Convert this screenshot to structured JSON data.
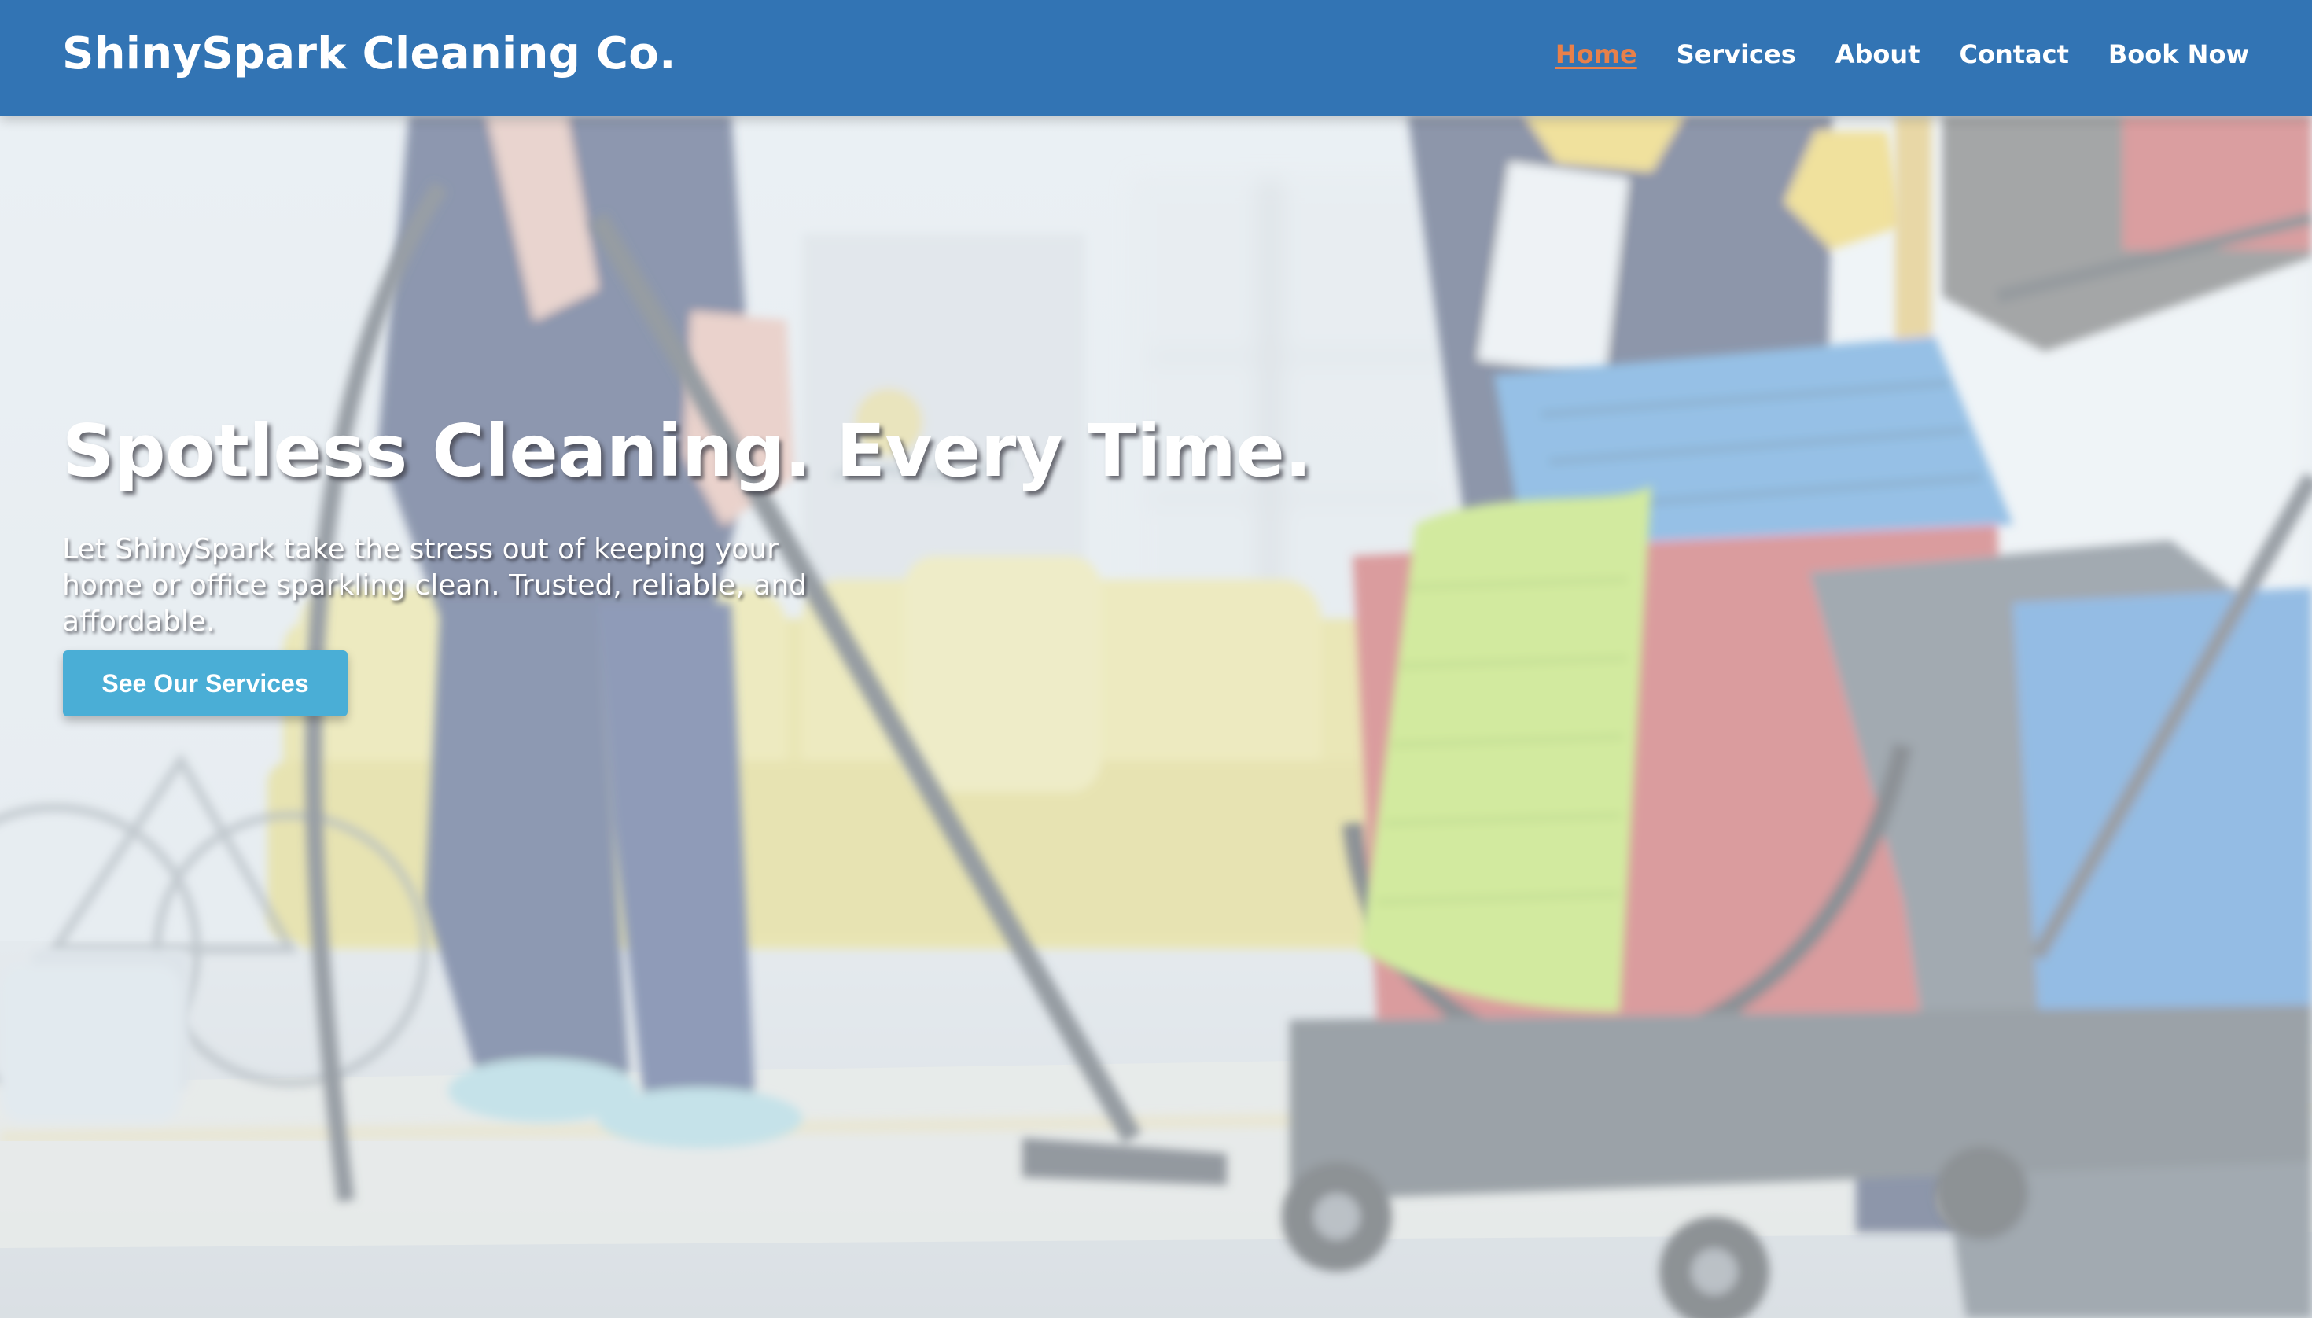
{
  "header": {
    "brand": "ShinySpark Cleaning Co.",
    "nav": [
      {
        "label": "Home",
        "active": true
      },
      {
        "label": "Services",
        "active": false
      },
      {
        "label": "About",
        "active": false
      },
      {
        "label": "Contact",
        "active": false
      },
      {
        "label": "Book Now",
        "active": false
      }
    ]
  },
  "hero": {
    "title": "Spotless Cleaning. Every Time.",
    "subtitle": "Let ShinySpark take the stress out of keeping your home or office sparkling clean. Trusted, reliable, and affordable.",
    "cta_label": "See Our Services"
  },
  "colors": {
    "header_bg": "#3274b4",
    "active_nav": "#e8804a",
    "cta_bg": "#4aaed6",
    "text": "#ffffff"
  }
}
